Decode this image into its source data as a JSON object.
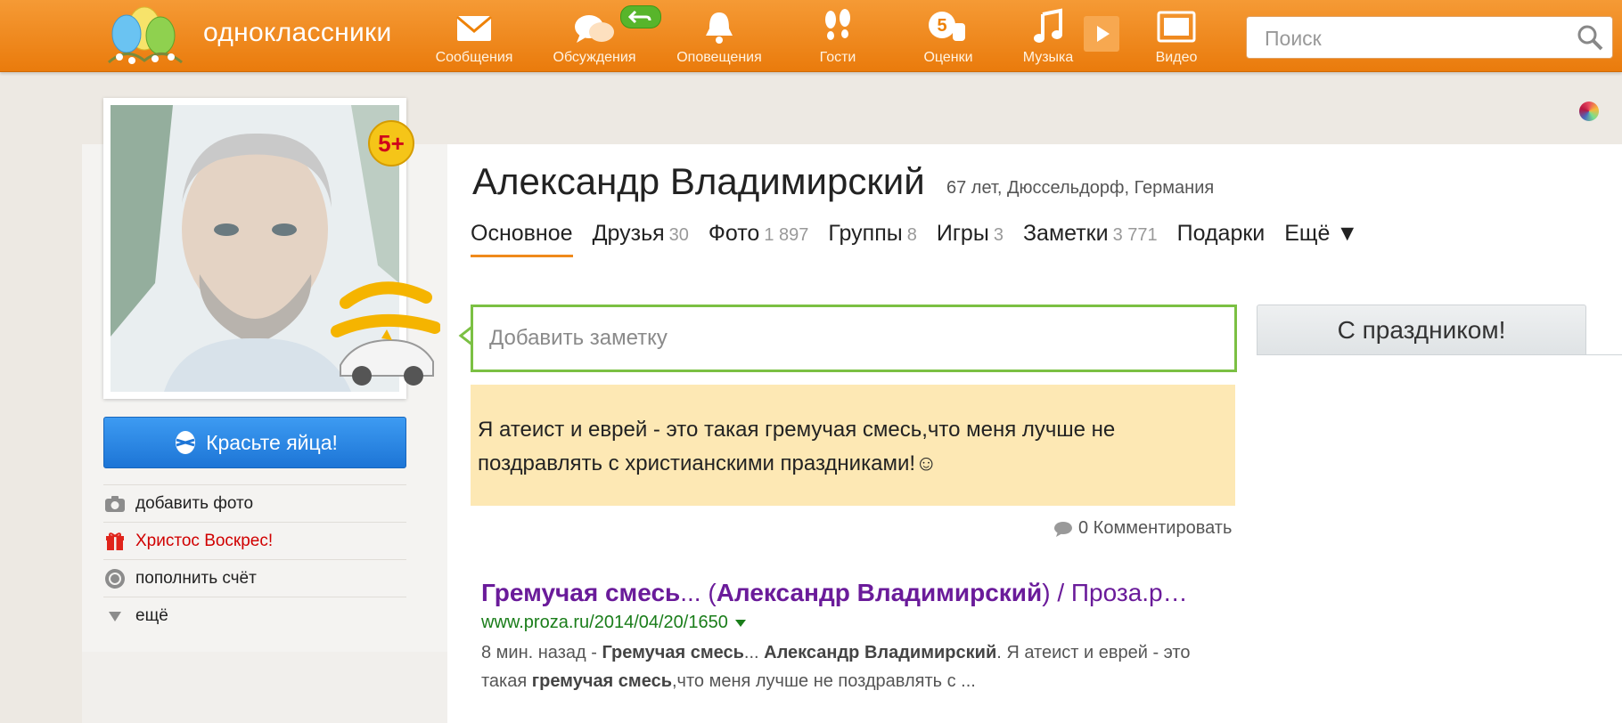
{
  "header": {
    "site_name": "одноклассники",
    "nav": [
      {
        "label": "Сообщения",
        "icon": "envelope-icon"
      },
      {
        "label": "Обсуждения",
        "icon": "chat-bubbles-icon"
      },
      {
        "label": "Оповещения",
        "icon": "bell-icon"
      },
      {
        "label": "Гости",
        "icon": "footprints-icon"
      },
      {
        "label": "Оценки",
        "icon": "rating-hand-icon"
      },
      {
        "label": "Музыка",
        "icon": "music-note-icon"
      },
      {
        "label": "Видео",
        "icon": "film-icon"
      }
    ],
    "search": {
      "placeholder": "Поиск"
    },
    "accent_color": "#ee8208"
  },
  "profile": {
    "age_badge": "5+",
    "name": "Александр Владимирский",
    "meta": "67 лет, Дюссельдорф, Германия",
    "tabs": [
      {
        "label": "Основное",
        "count": ""
      },
      {
        "label": "Друзья",
        "count": "30"
      },
      {
        "label": "Фото",
        "count": "1 897"
      },
      {
        "label": "Группы",
        "count": "8"
      },
      {
        "label": "Игры",
        "count": "3"
      },
      {
        "label": "Заметки",
        "count": "3 771"
      },
      {
        "label": "Подарки",
        "count": ""
      },
      {
        "label": "Ещё ▼",
        "count": ""
      }
    ]
  },
  "sidebar": {
    "cta_label": "Красьте яйца!",
    "items": [
      {
        "label": "добавить фото",
        "icon": "camera-icon"
      },
      {
        "label": "Христос Воскрес!",
        "icon": "gift-icon"
      },
      {
        "label": "пополнить счёт",
        "icon": "coin-icon"
      },
      {
        "label": "ещё",
        "icon": "triangle-down-icon"
      }
    ]
  },
  "feed": {
    "note_placeholder": "Добавить заметку",
    "status_text": "Я атеист и еврей - это такая гремучая смесь,что меня лучше не поздравлять с христианскими праздниками!☺",
    "comments_label": "0 Комментировать",
    "holiday_button": "С праздником!"
  },
  "search_result": {
    "title_bold_1": "Гремучая смесь",
    "title_mid": "... (",
    "title_bold_2": "Александр Владимирский",
    "title_tail": ") / Проза.р…",
    "url": "www.proza.ru/2014/04/20/1650",
    "snippet_time": "8 мин. назад - ",
    "snippet_b1": "Гремучая смесь",
    "snippet_t1": "... ",
    "snippet_b2": "Александр Владимирский",
    "snippet_t2": ". Я атеист и еврей - это такая ",
    "snippet_b3": "гремучая смесь",
    "snippet_t3": ",что меня лучше не поздравлять с ..."
  }
}
